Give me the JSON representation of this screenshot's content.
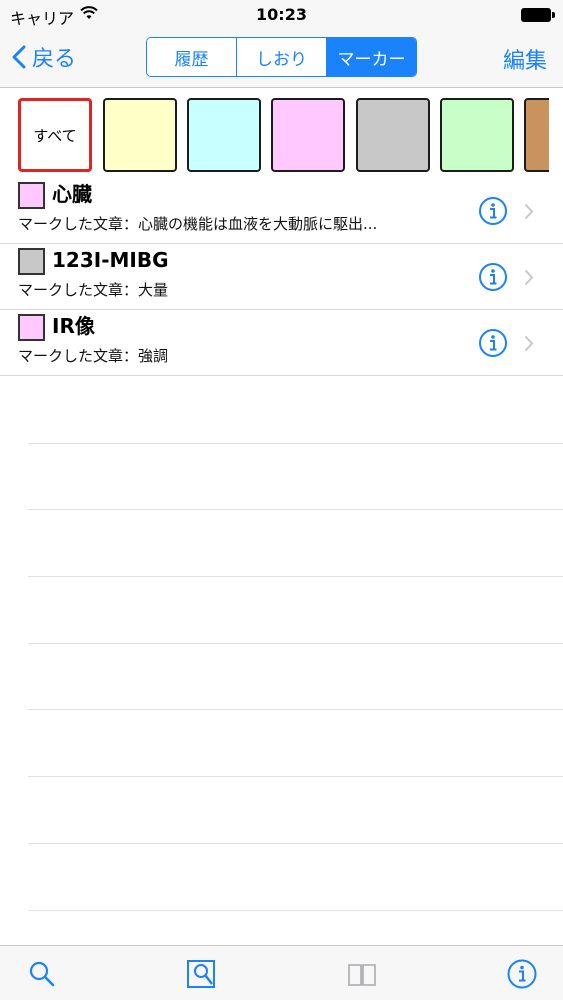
{
  "status_bar": {
    "carrier": "キャリア",
    "time": "10:23"
  },
  "nav": {
    "back_label": "戻る",
    "segments": [
      {
        "label": "履歴",
        "active": false
      },
      {
        "label": "しおり",
        "active": false
      },
      {
        "label": "マーカー",
        "active": true
      }
    ],
    "edit_label": "編集"
  },
  "colors": {
    "accent": "#1a82fb",
    "selected_border": "#e0241e"
  },
  "color_filter": {
    "all_label": "すべて",
    "swatches": [
      "#ffffc8",
      "#c8ffff",
      "#ffc8ff",
      "#c8c8c8",
      "#c8ffc8",
      "#c8935e"
    ]
  },
  "markers": [
    {
      "color": "#ffc8ff",
      "title": "心臓",
      "subtitle": "マークした文章：心臓の機能は血液を大動脈に駆出..."
    },
    {
      "color": "#c8c8c8",
      "title": "123I-MIBG",
      "subtitle": "マークした文章：大量"
    },
    {
      "color": "#ffc8ff",
      "title": "IR像",
      "subtitle": "マークした文章：強調"
    }
  ],
  "tab_bar": {
    "icons": [
      "search-icon",
      "search-document-icon",
      "book-icon",
      "info-icon"
    ]
  }
}
